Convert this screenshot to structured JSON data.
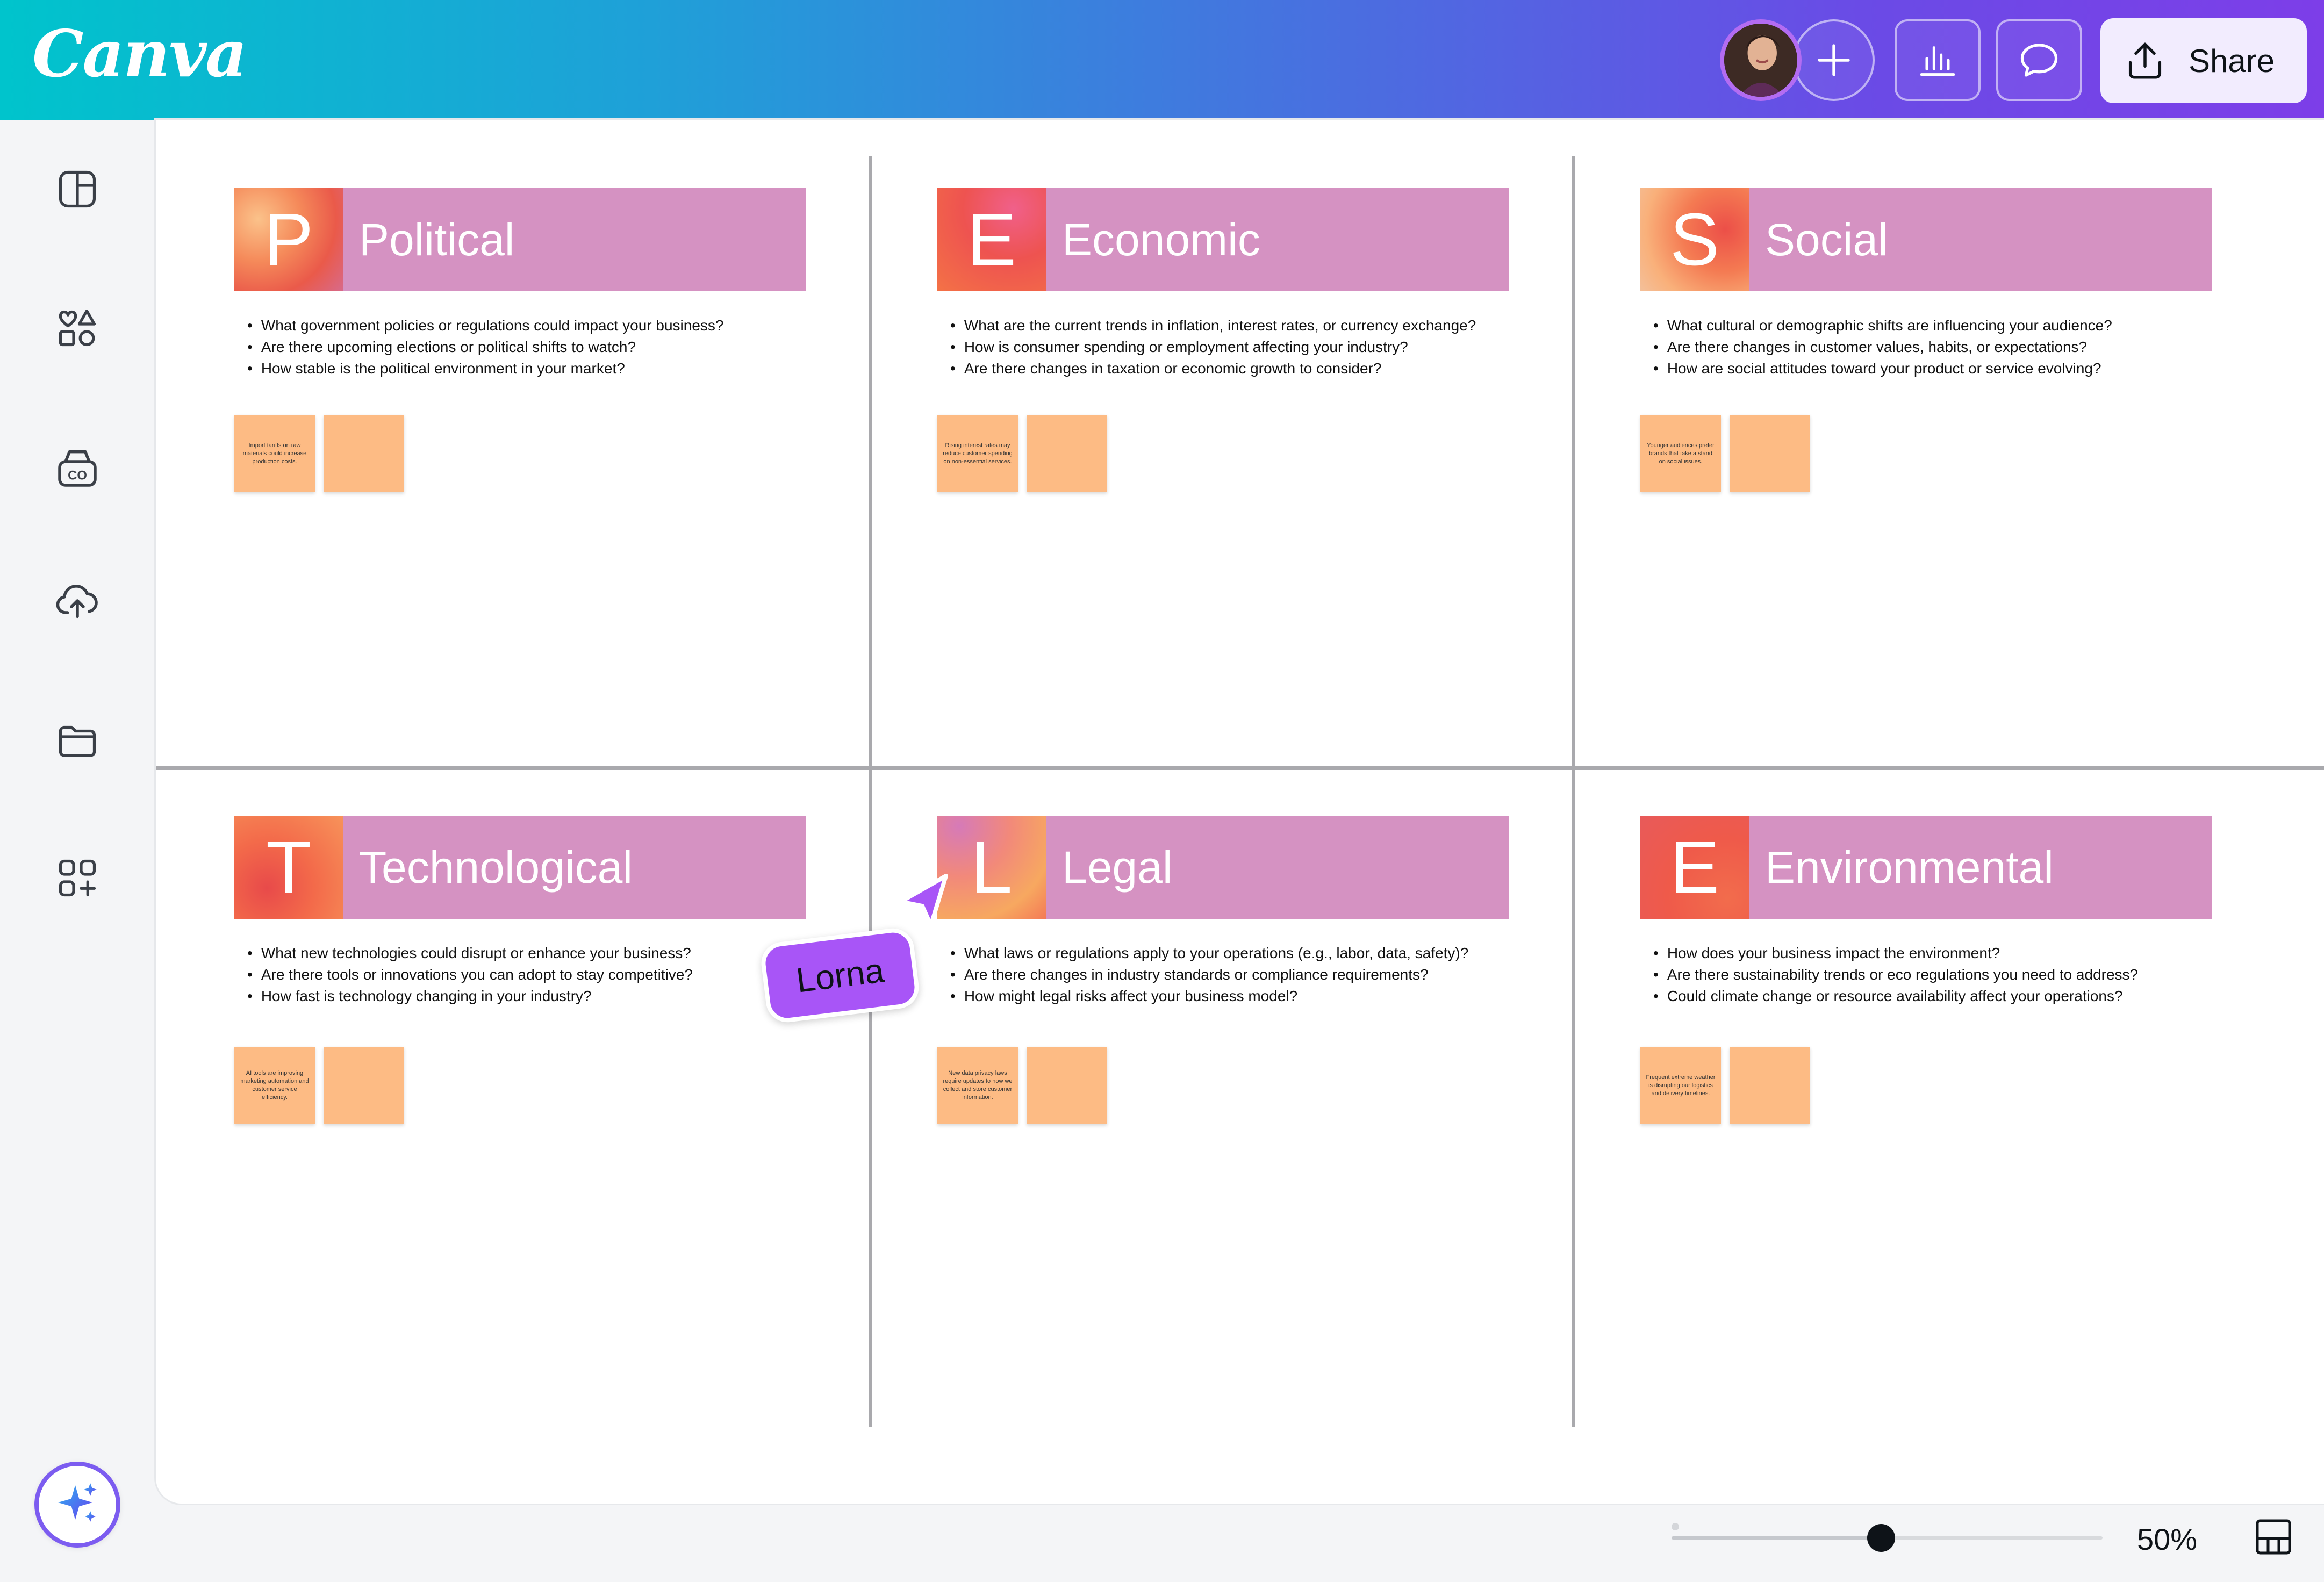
{
  "app": {
    "logo": "Canva"
  },
  "header": {
    "share_label": "Share"
  },
  "quadrants": [
    {
      "letter": "P",
      "title": "Political",
      "questions": [
        "What government policies or regulations could impact your business?",
        "Are there upcoming elections or political shifts to watch?",
        "How stable is the political environment in your market?"
      ],
      "note": "Import tariffs on raw materials could increase production costs."
    },
    {
      "letter": "E",
      "title": "Economic",
      "questions": [
        "What are the current trends in inflation, interest rates, or currency exchange?",
        "How is consumer spending or employment affecting your industry?",
        "Are there changes in taxation or economic growth to consider?"
      ],
      "note": "Rising interest rates may reduce customer spending on non-essential services."
    },
    {
      "letter": "S",
      "title": "Social",
      "questions": [
        "What cultural or demographic shifts are influencing your audience?",
        "Are there changes in customer values, habits, or expectations?",
        "How are social attitudes toward your product or service evolving?"
      ],
      "note": "Younger audiences prefer brands that take a stand on social issues."
    },
    {
      "letter": "T",
      "title": "Technological",
      "questions": [
        "What new technologies could disrupt or enhance your business?",
        "Are there tools or innovations you can adopt to stay competitive?",
        "How fast is technology changing in your industry?"
      ],
      "note": "AI tools are improving marketing automation and customer service efficiency."
    },
    {
      "letter": "L",
      "title": "Legal",
      "questions": [
        "What laws or regulations apply to your operations (e.g., labor, data, safety)?",
        "Are there changes in industry standards or compliance requirements?",
        "How might legal risks affect your business model?"
      ],
      "note": "New data privacy laws require updates to how we collect and store customer information."
    },
    {
      "letter": "E",
      "title": "Environmental",
      "questions": [
        "How does your business impact the environment?",
        "Are there sustainability trends or eco regulations you need to address?",
        "Could climate change or resource availability affect your operations?"
      ],
      "note": "Frequent extreme weather is disrupting our logistics and delivery timelines."
    }
  ],
  "collaborator": {
    "name": "Lorna",
    "color": "#a855f7"
  },
  "zoom": {
    "label": "50%",
    "value_percent": 50
  },
  "colors": {
    "header_gradient_start": "#00c4cc",
    "header_gradient_end": "#7d3ee8",
    "quadrant_header": "#d592c2",
    "sticky_note": "#fdbb84",
    "share_button_bg": "#f2ecfe"
  },
  "icons": {
    "header": [
      "plus-icon",
      "insights-icon",
      "comment-icon",
      "share-upload-icon"
    ],
    "sidebar": [
      "design-icon",
      "elements-icon",
      "brand-icon",
      "uploads-icon",
      "projects-icon",
      "apps-icon",
      "magic-sparkle-icon"
    ],
    "bottom": [
      "pages-grid-icon"
    ]
  }
}
